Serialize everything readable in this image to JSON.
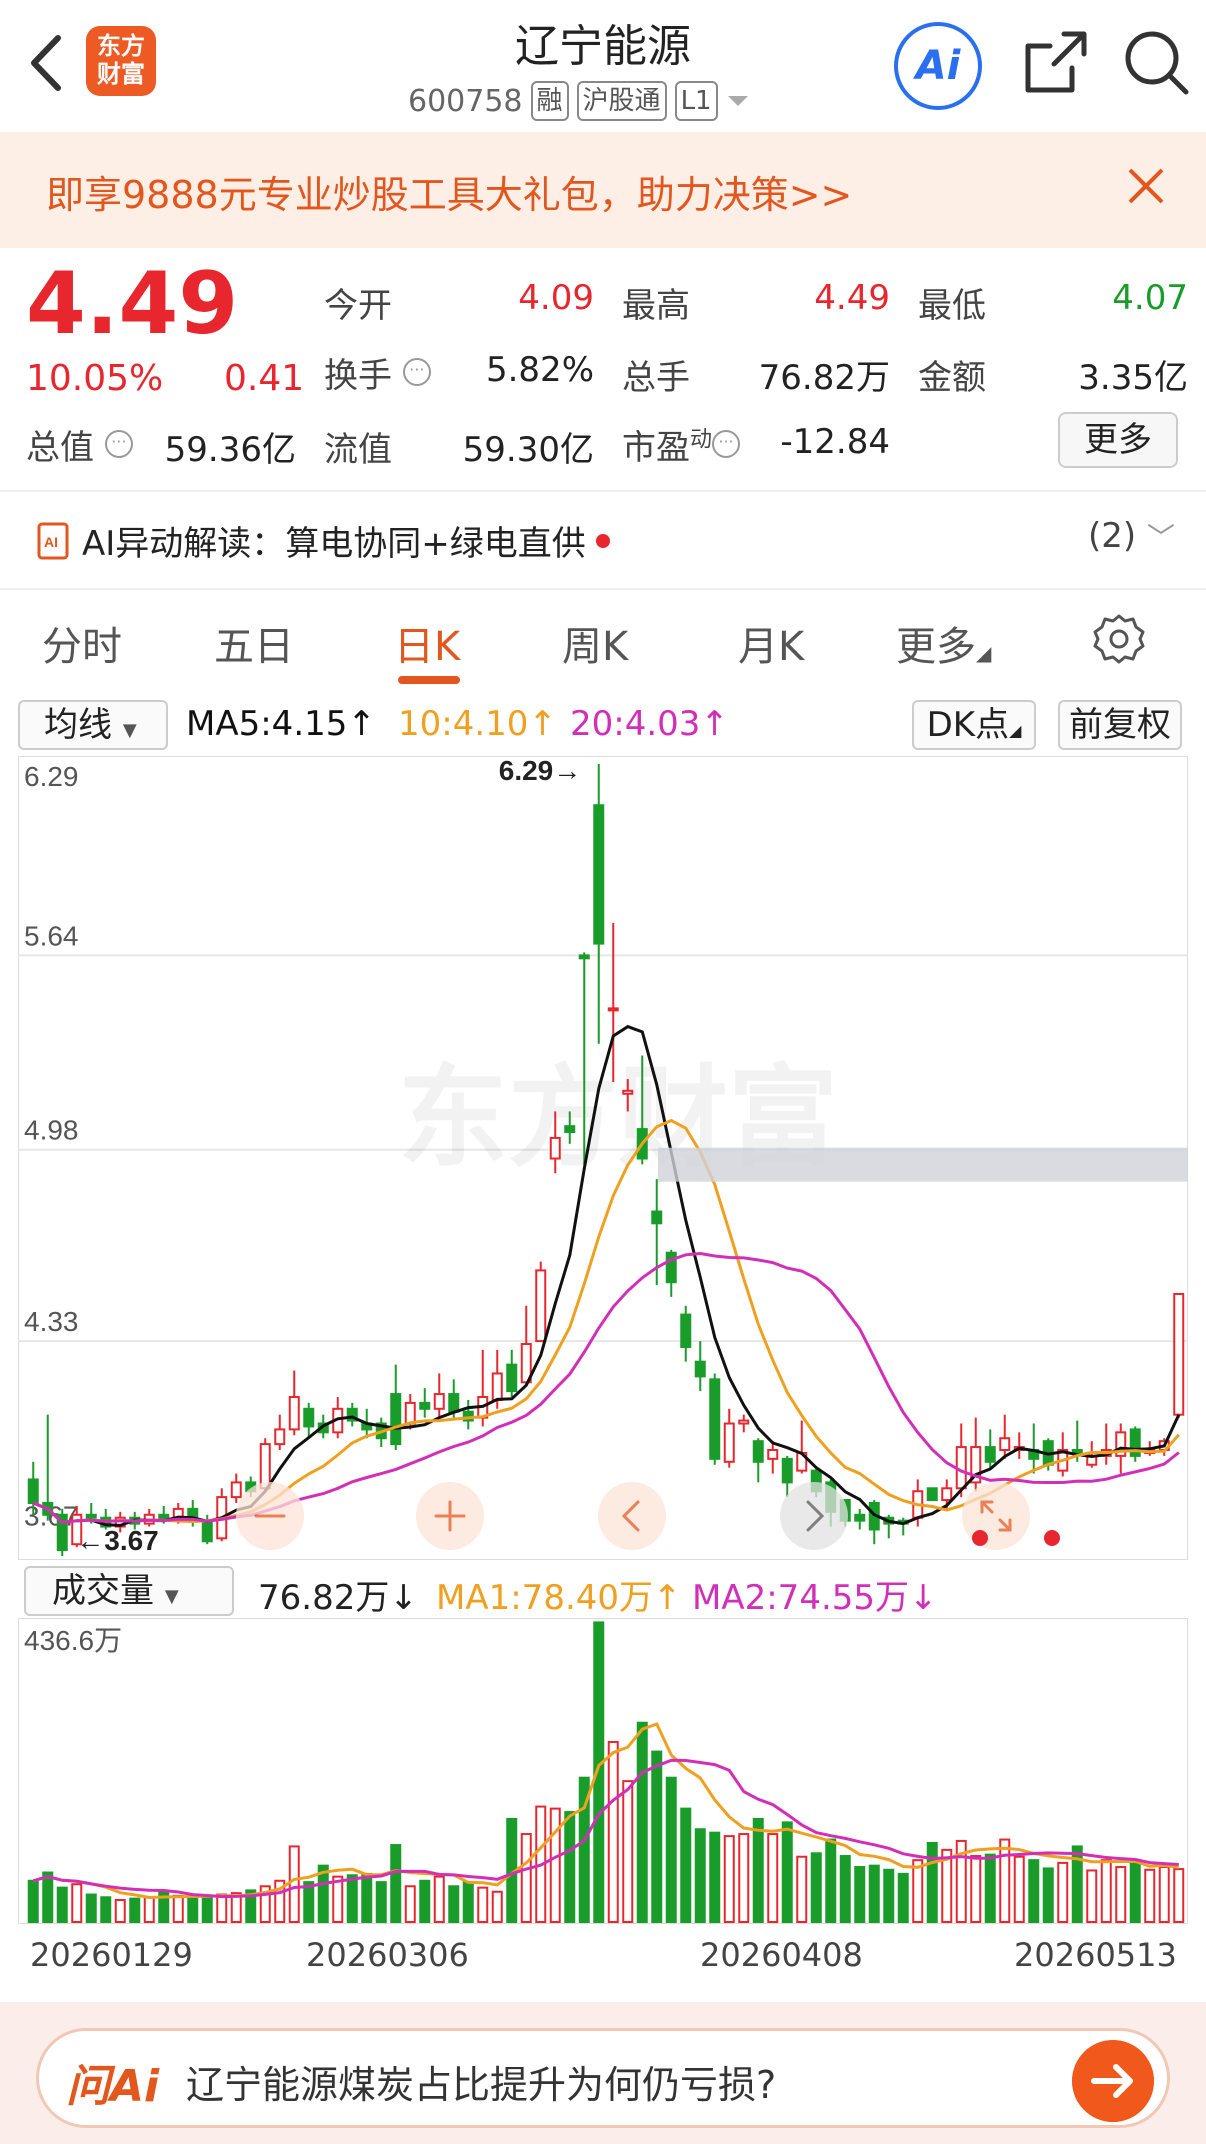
{
  "header": {
    "logo_line1": "东方",
    "logo_line2": "财富",
    "title": "辽宁能源",
    "code": "600758",
    "tags": [
      "融",
      "沪股通",
      "L1"
    ],
    "ai_label": "Ai"
  },
  "banner": {
    "text": "即享9888元专业炒股工具大礼包，助力决策>>"
  },
  "quote": {
    "price": "4.49",
    "change_pct": "10.05%",
    "change_amt": "0.41",
    "total_value_label": "总值",
    "total_value": "59.36亿",
    "open_label": "今开",
    "open": "4.09",
    "high_label": "最高",
    "high": "4.49",
    "low_label": "最低",
    "low": "4.07",
    "turnover_label": "换手",
    "turnover": "5.82%",
    "volume_label": "总手",
    "volume": "76.82万",
    "amount_label": "金额",
    "amount": "3.35亿",
    "float_label": "流值",
    "float_value": "59.30亿",
    "pe_label": "市盈",
    "pe_sup": "动",
    "pe": "-12.84",
    "more": "更多"
  },
  "ai_row": {
    "text": "AI异动解读：算电协同+绿电直供",
    "count": "(2)"
  },
  "tabs": [
    {
      "label": "分时"
    },
    {
      "label": "五日"
    },
    {
      "label": "日K"
    },
    {
      "label": "周K"
    },
    {
      "label": "月K"
    },
    {
      "label": "更多"
    }
  ],
  "indicators": {
    "ma_select": "均线",
    "ma5": "MA5:4.15↑",
    "ma10": "10:4.10↑",
    "ma20": "20:4.03↑",
    "dk": "DK点",
    "adjust": "前复权",
    "vol_select": "成交量",
    "vol_value": "76.82万↓",
    "vol_ma1": "MA1:78.40万↑",
    "vol_ma2": "MA2:74.55万↓",
    "colors": {
      "ma5": "#111111",
      "ma10": "#f0a020",
      "ma20": "#d22fb8",
      "up": "#e8262d",
      "down": "#1a9c2a"
    }
  },
  "chart_data": [
    {
      "type": "candlestick",
      "y_ticks": [
        "6.29",
        "5.64",
        "4.98",
        "4.33",
        "3.67"
      ],
      "ylim": [
        3.6,
        6.29
      ],
      "max_label": "6.29→",
      "min_label": "←3.67",
      "watermark": "东方财富",
      "dates": [
        "20260129",
        "20260306",
        "20260408",
        "20260513"
      ],
      "candles": [
        [
          3.86,
          3.78,
          3.92,
          3.74
        ],
        [
          3.78,
          3.74,
          4.08,
          3.72
        ],
        [
          3.74,
          3.62,
          3.76,
          3.6
        ],
        [
          3.64,
          3.74,
          3.77,
          3.63
        ],
        [
          3.74,
          3.73,
          3.78,
          3.71
        ],
        [
          3.73,
          3.7,
          3.76,
          3.69
        ],
        [
          3.7,
          3.73,
          3.75,
          3.68
        ],
        [
          3.73,
          3.71,
          3.75,
          3.69
        ],
        [
          3.71,
          3.74,
          3.76,
          3.7
        ],
        [
          3.74,
          3.72,
          3.77,
          3.71
        ],
        [
          3.72,
          3.76,
          3.78,
          3.71
        ],
        [
          3.76,
          3.72,
          3.79,
          3.7
        ],
        [
          3.72,
          3.65,
          3.74,
          3.64
        ],
        [
          3.66,
          3.8,
          3.83,
          3.65
        ],
        [
          3.8,
          3.85,
          3.88,
          3.78
        ],
        [
          3.85,
          3.82,
          3.87,
          3.8
        ],
        [
          3.83,
          3.98,
          4.0,
          3.82
        ],
        [
          3.98,
          4.03,
          4.08,
          3.96
        ],
        [
          4.03,
          4.14,
          4.23,
          4.01
        ],
        [
          4.1,
          4.04,
          4.12,
          4.0
        ],
        [
          4.05,
          4.02,
          4.08,
          4.0
        ],
        [
          4.02,
          4.1,
          4.14,
          4.0
        ],
        [
          4.1,
          4.06,
          4.12,
          4.04
        ],
        [
          4.05,
          4.03,
          4.1,
          4.0
        ],
        [
          4.05,
          4.0,
          4.07,
          3.97
        ],
        [
          4.15,
          3.98,
          4.25,
          3.96
        ],
        [
          4.05,
          4.12,
          4.15,
          4.03
        ],
        [
          4.12,
          4.1,
          4.17,
          4.07
        ],
        [
          4.1,
          4.15,
          4.22,
          4.06
        ],
        [
          4.15,
          4.09,
          4.2,
          4.06
        ],
        [
          4.09,
          4.06,
          4.13,
          4.03
        ],
        [
          4.07,
          4.14,
          4.3,
          4.04
        ],
        [
          4.13,
          4.22,
          4.3,
          4.1
        ],
        [
          4.25,
          4.16,
          4.3,
          4.14
        ],
        [
          4.19,
          4.32,
          4.45,
          4.18
        ],
        [
          4.33,
          4.57,
          4.6,
          4.33
        ],
        [
          4.95,
          5.02,
          5.11,
          4.9
        ],
        [
          5.06,
          5.04,
          5.11,
          5.0
        ],
        [
          5.64,
          5.63,
          5.65,
          4.93
        ],
        [
          6.15,
          5.68,
          6.29,
          5.34
        ],
        [
          5.46,
          5.46,
          5.75,
          5.21
        ],
        [
          5.17,
          5.18,
          5.22,
          5.11
        ],
        [
          5.05,
          4.95,
          5.3,
          4.93
        ],
        [
          4.77,
          4.73,
          4.88,
          4.52
        ],
        [
          4.63,
          4.53,
          4.64,
          4.48
        ],
        [
          4.42,
          4.31,
          4.45,
          4.26
        ],
        [
          4.26,
          4.21,
          4.33,
          4.16
        ],
        [
          4.2,
          3.93,
          4.22,
          3.91
        ],
        [
          3.92,
          4.05,
          4.1,
          3.9
        ],
        [
          4.05,
          4.06,
          4.08,
          4.02
        ],
        [
          3.99,
          3.92,
          4.0,
          3.85
        ],
        [
          3.93,
          3.96,
          3.99,
          3.88
        ],
        [
          3.93,
          3.85,
          3.94,
          3.8
        ],
        [
          3.89,
          3.95,
          4.06,
          3.88
        ],
        [
          3.89,
          3.82,
          3.9,
          3.8
        ],
        [
          3.85,
          3.75,
          3.86,
          3.7
        ],
        [
          3.79,
          3.72,
          3.79,
          3.7
        ],
        [
          3.74,
          3.72,
          3.76,
          3.69
        ],
        [
          3.78,
          3.69,
          3.79,
          3.64
        ],
        [
          3.73,
          3.71,
          3.74,
          3.66
        ],
        [
          3.72,
          3.71,
          3.73,
          3.67
        ],
        [
          3.73,
          3.82,
          3.86,
          3.7
        ],
        [
          3.83,
          3.79,
          3.83,
          3.79
        ],
        [
          3.79,
          3.83,
          3.86,
          3.76
        ],
        [
          3.83,
          3.97,
          4.05,
          3.8
        ],
        [
          3.85,
          3.97,
          4.07,
          3.82
        ],
        [
          3.97,
          3.92,
          4.03,
          3.9
        ],
        [
          3.96,
          4.0,
          4.08,
          3.93
        ],
        [
          3.96,
          3.97,
          4.02,
          3.93
        ],
        [
          3.96,
          3.93,
          4.05,
          3.88
        ],
        [
          3.99,
          3.91,
          4.0,
          3.89
        ],
        [
          3.89,
          3.96,
          4.02,
          3.87
        ],
        [
          3.96,
          3.95,
          4.06,
          3.92
        ],
        [
          3.91,
          3.94,
          3.99,
          3.9
        ],
        [
          3.94,
          3.96,
          4.05,
          3.91
        ],
        [
          3.94,
          4.02,
          4.05,
          3.88
        ],
        [
          4.03,
          3.94,
          4.04,
          3.92
        ],
        [
          3.95,
          3.96,
          3.99,
          3.94
        ],
        [
          3.96,
          3.99,
          4.0,
          3.94
        ],
        [
          4.08,
          4.49,
          4.49,
          4.07
        ]
      ]
    },
    {
      "type": "bar",
      "series_name": "成交量",
      "y_top_label": "436.6万",
      "ylim": [
        0,
        436.6
      ],
      "values": [
        60,
        72,
        50,
        55,
        40,
        36,
        32,
        34,
        36,
        44,
        38,
        34,
        36,
        40,
        42,
        46,
        52,
        60,
        110,
        58,
        82,
        66,
        68,
        70,
        58,
        112,
        52,
        60,
        66,
        52,
        58,
        50,
        44,
        150,
        128,
        168,
        165,
        160,
        210,
        436,
        262,
        205,
        290,
        248,
        210,
        165,
        135,
        130,
        125,
        128,
        150,
        128,
        145,
        95,
        100,
        120,
        96,
        80,
        82,
        76,
        70,
        90,
        115,
        105,
        118,
        96,
        98,
        120,
        95,
        90,
        78,
        86,
        110,
        75,
        90,
        80,
        85,
        76,
        80,
        77
      ]
    }
  ],
  "bottom": {
    "logo": "问Ai",
    "question": "辽宁能源煤炭占比提升为何仍亏损?"
  }
}
